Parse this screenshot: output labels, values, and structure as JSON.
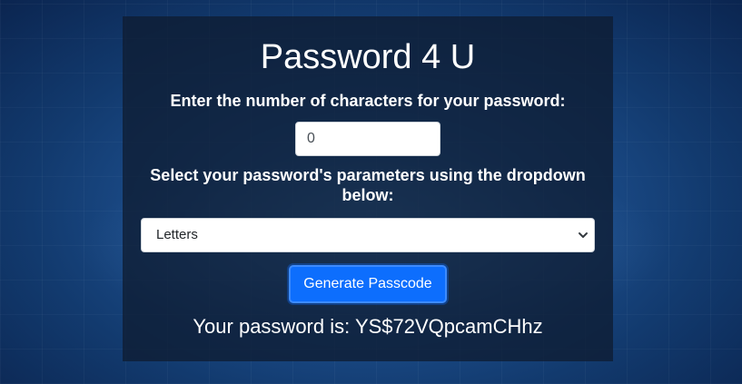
{
  "title": "Password 4 U",
  "count": {
    "label": "Enter the number of characters for your password:",
    "value": "0"
  },
  "params": {
    "label": "Select your password's parameters using the dropdown below:",
    "selected": "Letters"
  },
  "generate_label": "Generate Passcode",
  "result": {
    "prefix": "Your password is: ",
    "password": "YS$72VQpcamCHhz"
  },
  "icons": {
    "select": "chevron-down-icon"
  }
}
